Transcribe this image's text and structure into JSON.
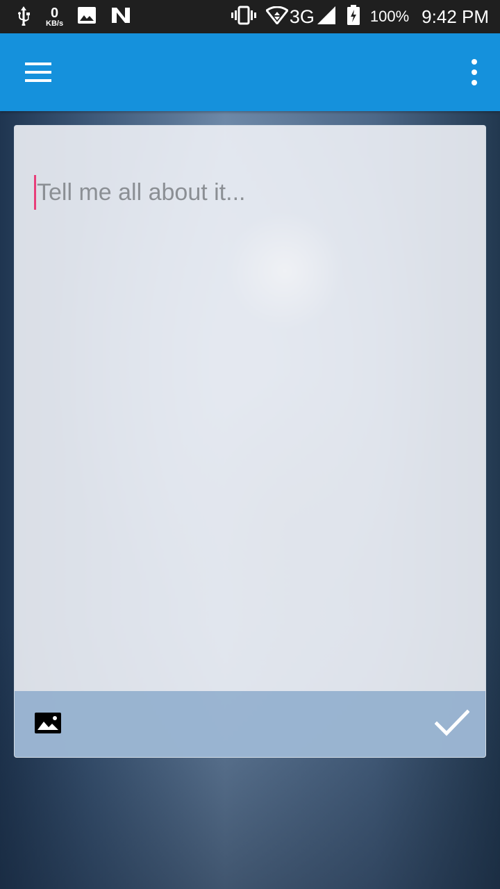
{
  "status_bar": {
    "net_speed_value": "0",
    "net_speed_unit": "KB/s",
    "network_type": "3G",
    "battery_percent": "100%",
    "time": "9:42 PM"
  },
  "editor": {
    "placeholder": "Tell me all about it..."
  },
  "colors": {
    "app_bar": "#1591dc",
    "cursor": "#e83e7a",
    "footer": "#8aaaca"
  }
}
